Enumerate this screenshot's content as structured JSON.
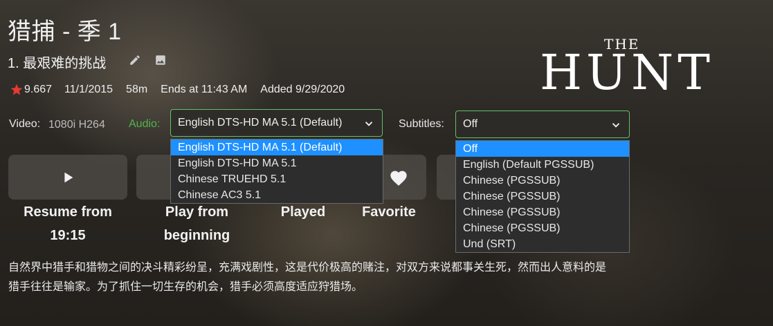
{
  "header": {
    "title": "猎捕 - 季 1",
    "episode_title": "1. 最艰难的挑战",
    "edit_icon": "pencil-icon",
    "image_icon": "image-icon"
  },
  "meta": {
    "rating": "9.667",
    "date": "11/1/2015",
    "runtime": "58m",
    "ends_at": "Ends at 11:43 AM",
    "added": "Added 9/29/2020",
    "star_color": "#e53935"
  },
  "logo": {
    "the": "THE",
    "hunt": "HUNT"
  },
  "streams": {
    "video_label": "Video:",
    "video_value": "1080i H264",
    "audio_label": "Audio:",
    "audio_label_color": "#52b54b",
    "audio_selected": "English DTS-HD MA 5.1 (Default)",
    "audio_options": [
      "English DTS-HD MA 5.1 (Default)",
      "English DTS-HD MA 5.1",
      "Chinese TRUEHD 5.1",
      "Chinese AC3 5.1"
    ],
    "subtitles_label": "Subtitles:",
    "subtitles_selected": "Off",
    "subtitle_options": [
      "Off",
      "English (Default PGSSUB)",
      "Chinese (PGSSUB)",
      "Chinese (PGSSUB)",
      "Chinese (PGSSUB)",
      "Chinese (PGSSUB)",
      "Und (SRT)"
    ],
    "highlight_color": "#1e90ff"
  },
  "actions": [
    {
      "label_line1": "Resume from",
      "label_line2": "19:15",
      "icon": "play-icon"
    },
    {
      "label_line1": "Play from",
      "label_line2": "beginning",
      "icon": "replay-icon"
    },
    {
      "label_line1": "Played",
      "label_line2": "",
      "icon": "check-icon"
    },
    {
      "label_line1": "Favorite",
      "label_line2": "",
      "icon": "heart-icon"
    }
  ],
  "overview": {
    "line1": "自然界中猎手和猎物之间的决斗精彩纷呈，充满戏剧性，这是代价极高的赌注，对双方来说都事关生死，然而出人意料的是",
    "line2": "猎手往往是输家。为了抓住一切生存的机会，猎手必须高度适应狩猎场。"
  }
}
